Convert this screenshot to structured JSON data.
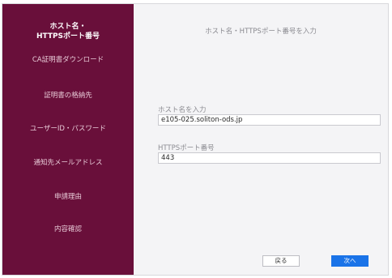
{
  "sidebar": {
    "active": {
      "line1": "ホスト名・",
      "line2": "HTTPSポート番号"
    },
    "items": [
      {
        "label": "CA証明書ダウンロード"
      },
      {
        "label": "証明書の格納先"
      },
      {
        "label": "ユーザーID・パスワード"
      },
      {
        "label": "通知先メールアドレス"
      },
      {
        "label": "申請理由"
      },
      {
        "label": "内容確認"
      }
    ]
  },
  "main": {
    "title": "ホスト名・HTTPSポート番号を入力",
    "hostname": {
      "label": "ホスト名を入力",
      "value": "e105-025.soliton-ods.jp"
    },
    "port": {
      "label": "HTTPSポート番号",
      "value": "443"
    },
    "buttons": {
      "back": "戻る",
      "next": "次へ"
    }
  },
  "colors": {
    "sidebar_bg": "#690f3a",
    "primary_button": "#1a73e8",
    "content_bg": "#f4f4f6"
  }
}
